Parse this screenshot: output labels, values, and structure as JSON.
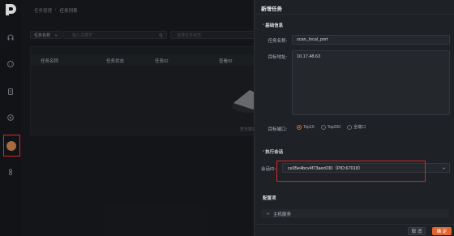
{
  "colors": {
    "accent": "#e0652f",
    "highlight_box": "#d9272e"
  },
  "rail": {
    "items": [
      {
        "icon": "headset-icon"
      },
      {
        "icon": "chat-icon"
      },
      {
        "icon": "document-icon"
      },
      {
        "icon": "settings-icon"
      },
      {
        "icon": "task-icon"
      },
      {
        "icon": "plugin-icon"
      }
    ]
  },
  "breadcrumb": {
    "parent": "任务管理",
    "separator": "/",
    "current": "任务列表"
  },
  "filters": {
    "field_select": "任务名称",
    "keyword_placeholder": "输入关键字",
    "status_placeholder": "选择任务状态"
  },
  "table": {
    "columns": [
      "任务名称",
      "任务状态",
      "任务ID",
      "查看ID"
    ],
    "empty_text": "暂无数据"
  },
  "drawer": {
    "title": "新增任务",
    "basic_section": "基础信息",
    "task_name_label": "任务名称:",
    "task_name_value": "scan_local_port",
    "target_label": "目标地址:",
    "target_value": "10.17.48.63",
    "ports_label": "目标端口:",
    "port_options": [
      "Top10",
      "Top200",
      "全端口"
    ],
    "port_selected": "Top10",
    "executor_section": "执行会话",
    "executor_label": "会话ID:",
    "executor_value": "ce05e4bcv4f73aec030（PID:67018）",
    "config_section": "配置项",
    "config_item": "主机服务",
    "cancel_label": "取 消",
    "ok_label": "确 定"
  }
}
